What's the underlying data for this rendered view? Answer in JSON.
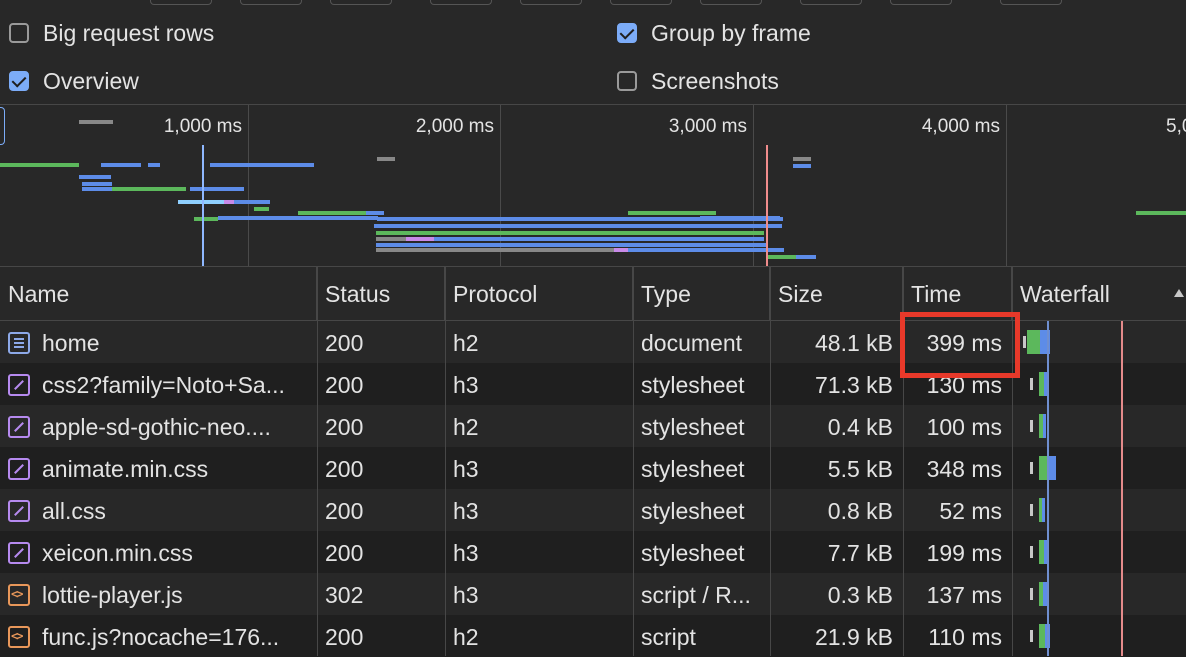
{
  "settings": {
    "big_request_rows": {
      "label": "Big request rows",
      "checked": false
    },
    "overview": {
      "label": "Overview",
      "checked": true
    },
    "group_by_frame": {
      "label": "Group by frame",
      "checked": true
    },
    "screenshots": {
      "label": "Screenshots",
      "checked": false
    }
  },
  "overview": {
    "ticks": [
      "1,000 ms",
      "2,000 ms",
      "3,000 ms",
      "4,000 ms",
      "5,0"
    ]
  },
  "table": {
    "columns": {
      "name": "Name",
      "status": "Status",
      "protocol": "Protocol",
      "type": "Type",
      "size": "Size",
      "time": "Time",
      "waterfall": "Waterfall"
    },
    "rows": [
      {
        "icon": "document-icon",
        "name": "home",
        "status": "200",
        "protocol": "h2",
        "type": "document",
        "size": "48.1 kB",
        "time": "399 ms"
      },
      {
        "icon": "stylesheet-icon",
        "name": "css2?family=Noto+Sa...",
        "status": "200",
        "protocol": "h3",
        "type": "stylesheet",
        "size": "71.3 kB",
        "time": "130 ms"
      },
      {
        "icon": "stylesheet-icon",
        "name": "apple-sd-gothic-neo....",
        "status": "200",
        "protocol": "h2",
        "type": "stylesheet",
        "size": "0.4 kB",
        "time": "100 ms"
      },
      {
        "icon": "stylesheet-icon",
        "name": "animate.min.css",
        "status": "200",
        "protocol": "h3",
        "type": "stylesheet",
        "size": "5.5 kB",
        "time": "348 ms"
      },
      {
        "icon": "stylesheet-icon",
        "name": "all.css",
        "status": "200",
        "protocol": "h3",
        "type": "stylesheet",
        "size": "0.8 kB",
        "time": "52 ms"
      },
      {
        "icon": "stylesheet-icon",
        "name": "xeicon.min.css",
        "status": "200",
        "protocol": "h3",
        "type": "stylesheet",
        "size": "7.7 kB",
        "time": "199 ms"
      },
      {
        "icon": "script-icon",
        "name": "lottie-player.js",
        "status": "302",
        "protocol": "h3",
        "type": "script / R...",
        "size": "0.3 kB",
        "time": "137 ms"
      },
      {
        "icon": "script-icon",
        "name": "func.js?nocache=176...",
        "status": "200",
        "protocol": "h2",
        "type": "script",
        "size": "21.9 kB",
        "time": "110 ms"
      }
    ]
  },
  "colors": {
    "accent": "#7cacf8",
    "highlight": "#e8392a",
    "waiting": "#5cb85c",
    "download": "#5d8ce8"
  }
}
